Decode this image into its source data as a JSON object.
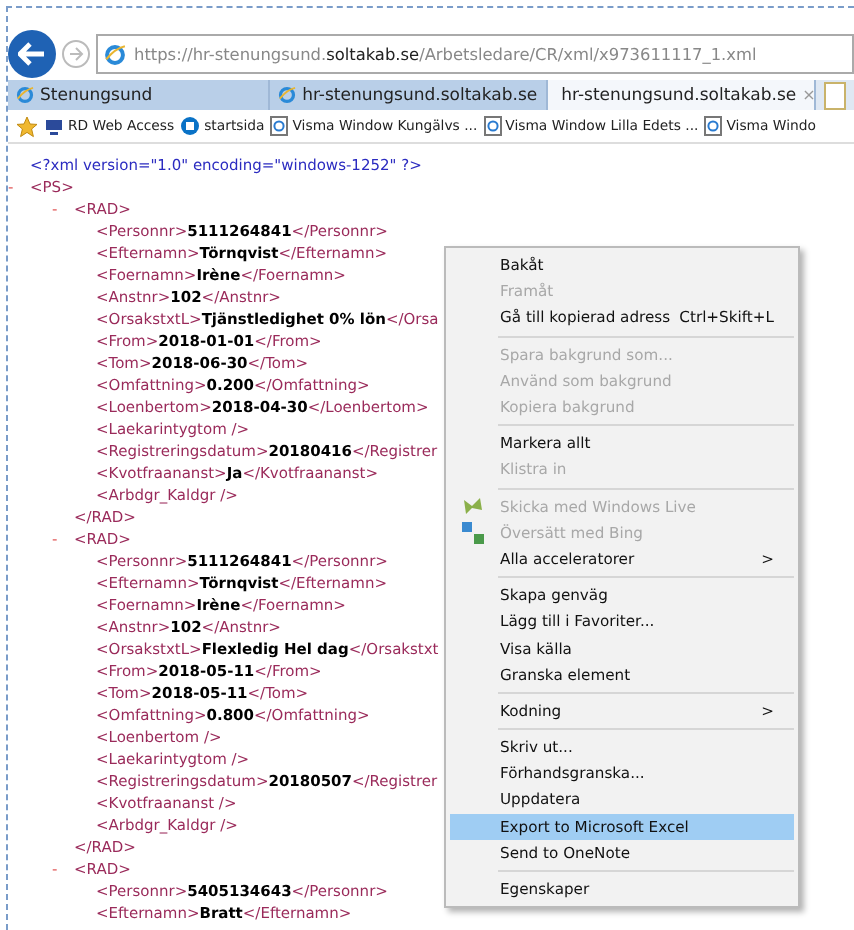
{
  "browser": {
    "address": "https://hr-stenungsund.**soltakab.se**/Arbetsledare/CR/xml/x973611117_1.xml",
    "tabs": [
      {
        "label": "Stenungsund",
        "selected": false
      },
      {
        "label": "hr-stenungsund.soltakab.se",
        "selected": false
      },
      {
        "label": "hr-stenungsund.soltakab.se",
        "selected": true,
        "close": "×"
      }
    ],
    "favorites": [
      {
        "label": "RD Web Access",
        "kind": "remote"
      },
      {
        "label": "startsida",
        "kind": "share"
      },
      {
        "label": "Visma Window Kungälvs ...",
        "kind": "page"
      },
      {
        "label": "Visma Window Lilla Edets ...",
        "kind": "page"
      },
      {
        "label": "Visma Windo",
        "kind": "page"
      }
    ]
  },
  "xml": {
    "declaration": "<?xml version=\"1.0\" encoding=\"windows-1252\" ?>",
    "root": {
      "toggle": "-",
      "open": "<PS>",
      "children": [
        {
          "toggle": "-",
          "open": "<RAD>",
          "close": "</RAD>",
          "children": [
            {
              "open": "<Personnr>",
              "value": "5111264841",
              "close": "</Personnr>"
            },
            {
              "open": "<Efternamn>",
              "value": "Törnqvist",
              "close": "</Efternamn>"
            },
            {
              "open": "<Foernamn>",
              "value": "Irène",
              "close": "</Foernamn>"
            },
            {
              "open": "<Anstnr>",
              "value": "102",
              "close": "</Anstnr>"
            },
            {
              "open": "<OrsakstxtL>",
              "value": "Tjänstledighet 0% lön",
              "close": "</Orsa"
            },
            {
              "open": "<From>",
              "value": "2018-01-01",
              "close": "</From>"
            },
            {
              "open": "<Tom>",
              "value": "2018-06-30",
              "close": "</Tom>"
            },
            {
              "open": "<Omfattning>",
              "value": "0.200",
              "close": "</Omfattning>"
            },
            {
              "open": "<Loenbertom>",
              "value": "2018-04-30",
              "close": "</Loenbertom>"
            },
            {
              "open": "<Laekarintygtom />"
            },
            {
              "open": "<Registreringsdatum>",
              "value": "20180416",
              "close": "</Registrer"
            },
            {
              "open": "<Kvotfraananst>",
              "value": "Ja",
              "close": "</Kvotfraananst>"
            },
            {
              "open": "<Arbdgr_Kaldgr />"
            }
          ]
        },
        {
          "toggle": "-",
          "open": "<RAD>",
          "close": "</RAD>",
          "children": [
            {
              "open": "<Personnr>",
              "value": "5111264841",
              "close": "</Personnr>"
            },
            {
              "open": "<Efternamn>",
              "value": "Törnqvist",
              "close": "</Efternamn>"
            },
            {
              "open": "<Foernamn>",
              "value": "Irène",
              "close": "</Foernamn>"
            },
            {
              "open": "<Anstnr>",
              "value": "102",
              "close": "</Anstnr>"
            },
            {
              "open": "<OrsakstxtL>",
              "value": "Flexledig Hel dag",
              "close": "</Orsakstxt"
            },
            {
              "open": "<From>",
              "value": "2018-05-11",
              "close": "</From>"
            },
            {
              "open": "<Tom>",
              "value": "2018-05-11",
              "close": "</Tom>"
            },
            {
              "open": "<Omfattning>",
              "value": "0.800",
              "close": "</Omfattning>"
            },
            {
              "open": "<Loenbertom />"
            },
            {
              "open": "<Laekarintygtom />"
            },
            {
              "open": "<Registreringsdatum>",
              "value": "20180507",
              "close": "</Registrer"
            },
            {
              "open": "<Kvotfraananst />"
            },
            {
              "open": "<Arbdgr_Kaldgr />"
            }
          ]
        },
        {
          "toggle": "-",
          "open": "<RAD>",
          "children": [
            {
              "open": "<Personnr>",
              "value": "5405134643",
              "close": "</Personnr>"
            },
            {
              "open": "<Efternamn>",
              "value": "Bratt",
              "close": "</Efternamn>"
            }
          ]
        }
      ]
    }
  },
  "context_menu": [
    {
      "kind": "item",
      "label": "Bakåt",
      "disabled": false
    },
    {
      "kind": "item",
      "label": "Framåt",
      "disabled": true
    },
    {
      "kind": "item",
      "label": "Gå till kopierad adress",
      "shortcut": "Ctrl+Skift+L",
      "disabled": false
    },
    {
      "kind": "separator"
    },
    {
      "kind": "item",
      "label": "Spara bakgrund som...",
      "disabled": true
    },
    {
      "kind": "item",
      "label": "Använd som bakgrund",
      "disabled": true
    },
    {
      "kind": "item",
      "label": "Kopiera bakgrund",
      "disabled": true
    },
    {
      "kind": "separator"
    },
    {
      "kind": "item",
      "label": "Markera allt",
      "disabled": false
    },
    {
      "kind": "item",
      "label": "Klistra in",
      "disabled": true
    },
    {
      "kind": "separator"
    },
    {
      "kind": "live",
      "label": "Skicka med Windows Live",
      "disabled": true
    },
    {
      "kind": "translate",
      "label": "Översätt med Bing",
      "disabled": true
    },
    {
      "kind": "item",
      "label": "Alla acceleratorer",
      "submenu": ">",
      "disabled": false
    },
    {
      "kind": "separator"
    },
    {
      "kind": "item",
      "label": "Skapa genväg",
      "disabled": false
    },
    {
      "kind": "item",
      "label": "Lägg till i Favoriter...",
      "disabled": false
    },
    {
      "kind": "item",
      "label": "Visa källa",
      "disabled": false
    },
    {
      "kind": "item",
      "label": "Granska element",
      "disabled": false
    },
    {
      "kind": "separator"
    },
    {
      "kind": "item",
      "label": "Kodning",
      "submenu": ">",
      "disabled": false
    },
    {
      "kind": "separator"
    },
    {
      "kind": "item",
      "label": "Skriv ut...",
      "disabled": false
    },
    {
      "kind": "item",
      "label": "Förhandsgranska...",
      "disabled": false
    },
    {
      "kind": "item",
      "label": "Uppdatera",
      "disabled": false
    },
    {
      "kind": "item",
      "label": "Export to Microsoft Excel",
      "disabled": false,
      "selected": true
    },
    {
      "kind": "item",
      "label": "Send to OneNote",
      "disabled": false
    },
    {
      "kind": "separator"
    },
    {
      "kind": "item",
      "label": "Egenskaper",
      "disabled": false
    }
  ]
}
